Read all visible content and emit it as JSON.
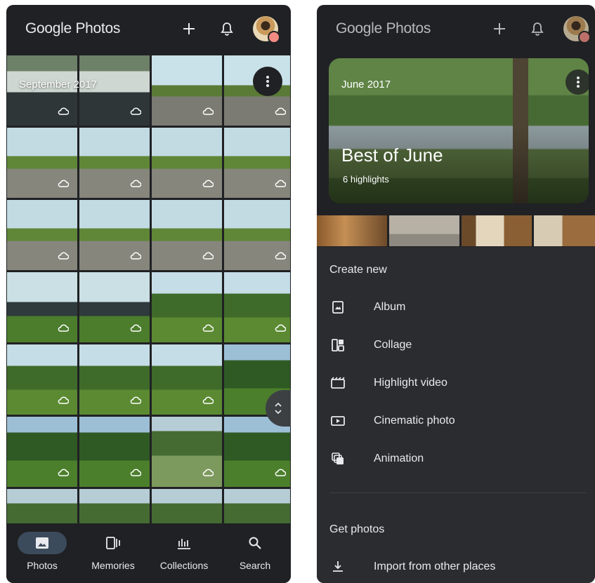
{
  "left_screen": {
    "app_title_part1": "Google",
    "app_title_part2": "Photos",
    "month_label": "September 2017",
    "nav": [
      {
        "label": "Photos",
        "icon": "photo-icon",
        "selected": true
      },
      {
        "label": "Memories",
        "icon": "memories-icon",
        "selected": false
      },
      {
        "label": "Collections",
        "icon": "collections-icon",
        "selected": false
      },
      {
        "label": "Search",
        "icon": "search-icon",
        "selected": false
      }
    ]
  },
  "right_screen": {
    "app_title_part1": "Google",
    "app_title_part2": "Photos",
    "memory": {
      "month": "June 2017",
      "title": "Best of June",
      "subtitle": "6 highlights"
    },
    "create_new": {
      "heading": "Create new",
      "items": [
        {
          "label": "Album",
          "icon": "album-icon"
        },
        {
          "label": "Collage",
          "icon": "collage-icon"
        },
        {
          "label": "Highlight video",
          "icon": "highlight-video-icon"
        },
        {
          "label": "Cinematic photo",
          "icon": "cinematic-photo-icon"
        },
        {
          "label": "Animation",
          "icon": "animation-icon"
        }
      ]
    },
    "get_photos": {
      "heading": "Get photos",
      "items": [
        {
          "label": "Import from other places",
          "icon": "import-icon"
        }
      ]
    }
  },
  "colors": {
    "background": "#202124",
    "sheet": "#2b2c2f",
    "text": "#e8eaed",
    "selected_pill": "#3c4b5c",
    "badge": "#f28b82"
  }
}
